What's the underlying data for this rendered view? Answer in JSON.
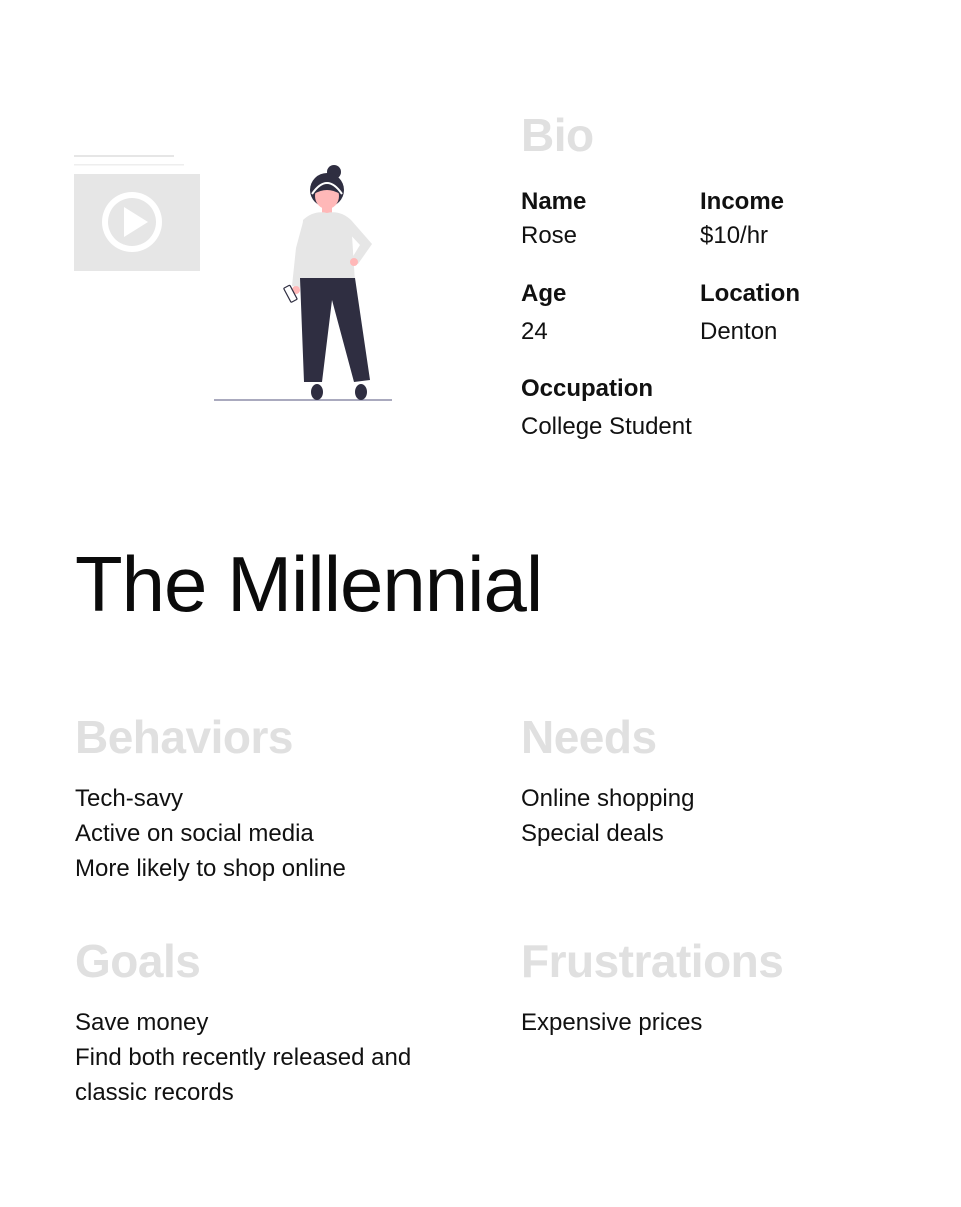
{
  "illustration": {
    "video_icon": "play-icon",
    "figure": "standing-person-illustration"
  },
  "bio": {
    "heading": "Bio",
    "fields": [
      {
        "label": "Name",
        "value": "Rose"
      },
      {
        "label": "Income",
        "value": "$10/hr"
      },
      {
        "label": "Age",
        "value": "24"
      },
      {
        "label": "Location",
        "value": "Denton"
      },
      {
        "label": "Occupation",
        "value": "College Student"
      }
    ]
  },
  "title": "The Millennial",
  "sections": {
    "behaviors": {
      "heading": "Behaviors",
      "items": [
        "Tech-savy",
        "Active on social media",
        "More likely to shop online"
      ]
    },
    "needs": {
      "heading": "Needs",
      "items": [
        "Online shopping",
        "Special deals"
      ]
    },
    "goals": {
      "heading": "Goals",
      "items": [
        "Save money",
        "Find both recently released and",
        "classic records"
      ]
    },
    "frustrations": {
      "heading": "Frustrations",
      "items": [
        "Expensive prices"
      ]
    }
  },
  "colors": {
    "heading_grey": "#e0e0e0",
    "text": "#111111",
    "figure_dark": "#2f2e41",
    "figure_light": "#e6e6e6",
    "skin": "#ffb8b8"
  }
}
